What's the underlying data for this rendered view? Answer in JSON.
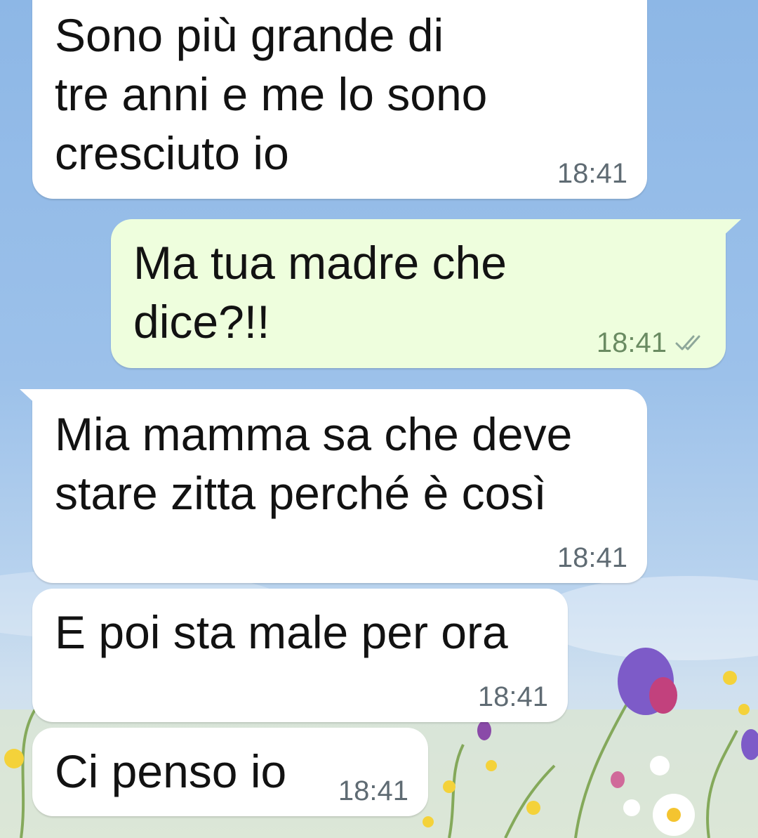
{
  "chat": {
    "messages": [
      {
        "direction": "incoming",
        "text": "Sono più grande di\ntre anni e me lo sono\ncresciuto io",
        "time": "18:41"
      },
      {
        "direction": "outgoing",
        "text": "Ma tua madre che\ndice?!!",
        "time": "18:41",
        "status_icon": "double-check-icon"
      },
      {
        "direction": "incoming",
        "text": "Mia mamma sa che deve\nstare zitta perché è così",
        "time": "18:41"
      },
      {
        "direction": "incoming",
        "text": "E poi sta male per ora",
        "time": "18:41"
      },
      {
        "direction": "incoming",
        "text": "Ci penso io",
        "time": "18:41"
      }
    ]
  },
  "colors": {
    "incoming_bubble": "#ffffff",
    "outgoing_bubble": "#eefedd",
    "wallpaper_sky": "#8db7e6"
  }
}
